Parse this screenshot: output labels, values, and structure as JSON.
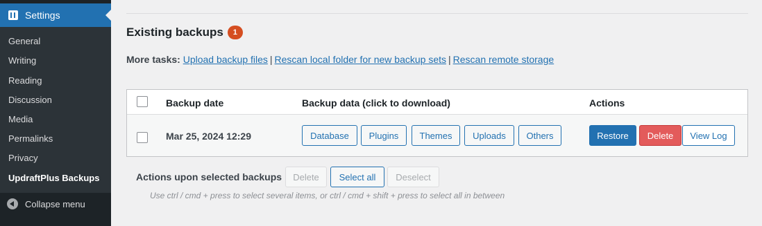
{
  "sidebar": {
    "header_label": "Settings",
    "items": [
      {
        "label": "General"
      },
      {
        "label": "Writing"
      },
      {
        "label": "Reading"
      },
      {
        "label": "Discussion"
      },
      {
        "label": "Media"
      },
      {
        "label": "Permalinks"
      },
      {
        "label": "Privacy"
      },
      {
        "label": "UpdraftPlus Backups",
        "active": true
      }
    ],
    "collapse_label": "Collapse menu"
  },
  "main": {
    "heading": "Existing backups",
    "count_badge": "1",
    "more_tasks": {
      "label": "More tasks:",
      "links": [
        "Upload backup files",
        "Rescan local folder for new backup sets",
        "Rescan remote storage"
      ],
      "separator": "|"
    },
    "table": {
      "headers": [
        "Backup date",
        "Backup data (click to download)",
        "Actions"
      ],
      "rows": [
        {
          "date": "Mar 25, 2024 12:29",
          "data_buttons": [
            "Database",
            "Plugins",
            "Themes",
            "Uploads",
            "Others"
          ],
          "actions": [
            "Restore",
            "Delete",
            "View Log"
          ]
        }
      ]
    },
    "bulk": {
      "label": "Actions upon selected backups",
      "buttons": [
        "Delete",
        "Select all",
        "Deselect"
      ],
      "hint": "Use ctrl / cmd + press to select several items, or ctrl / cmd + shift + press to select all in between"
    }
  },
  "colors": {
    "accent": "#2271b1",
    "sidebar_bg": "#1d2327",
    "badge": "#d54e21",
    "danger": "#e35b5b"
  }
}
